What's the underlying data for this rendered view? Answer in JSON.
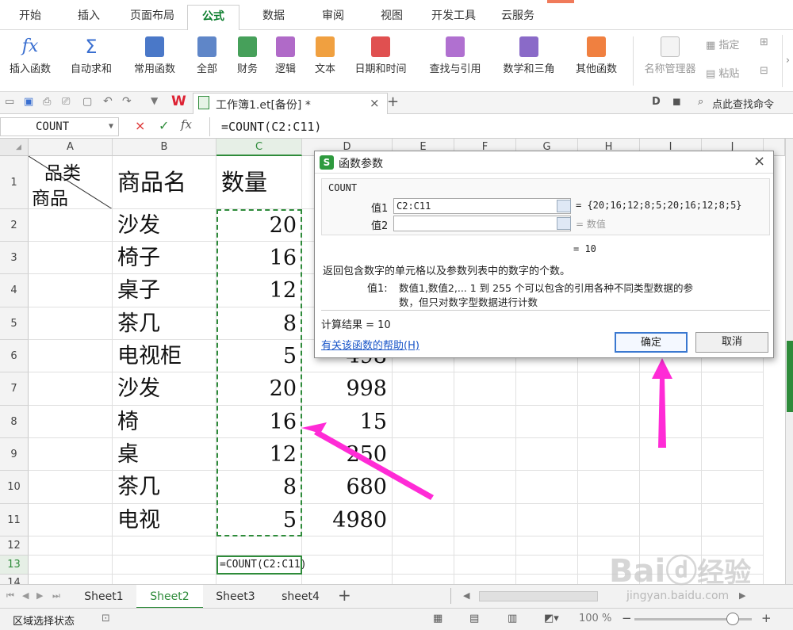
{
  "menu_tabs": [
    "开始",
    "插入",
    "页面布局",
    "公式",
    "数据",
    "审阅",
    "视图",
    "开发工具",
    "云服务"
  ],
  "active_menu_tab": "公式",
  "ribbon": {
    "items": [
      "插入函数",
      "自动求和",
      "常用函数",
      "全部",
      "财务",
      "逻辑",
      "文本",
      "日期和时间",
      "查找与引用",
      "数学和三角",
      "其他函数"
    ],
    "right_items": [
      "名称管理器",
      "指定",
      "粘贴"
    ],
    "fx_glyph": "fx",
    "sum_glyph": "Σ"
  },
  "doc_tab": {
    "title": "工作簿1.et[备份] *",
    "close": "×",
    "add": "+"
  },
  "tab_right": {
    "find": "点此查找命令"
  },
  "formula_bar": {
    "name_box": "COUNT",
    "cancel": "×",
    "confirm": "✓",
    "fx": "fx",
    "formula": "=COUNT(C2:C11)"
  },
  "columns": [
    "A",
    "B",
    "C",
    "D",
    "E",
    "F",
    "G",
    "H",
    "I",
    "J"
  ],
  "rows": [
    "1",
    "2",
    "3",
    "4",
    "5",
    "6",
    "7",
    "8",
    "9",
    "10",
    "11",
    "12",
    "13",
    "14"
  ],
  "header_cells": {
    "a1_top": "品类",
    "a1_bottom": "商品",
    "b1": "商品名",
    "c1": "数量"
  },
  "products": [
    "沙发",
    "椅子",
    "桌子",
    "茶几",
    "电视柜",
    "沙发",
    "椅",
    "桌",
    "茶几",
    "电视"
  ],
  "quantities": [
    "20",
    "16",
    "12",
    "8",
    "5",
    "20",
    "16",
    "12",
    "8",
    "5"
  ],
  "d_values": [
    "",
    "",
    "",
    "",
    "498",
    "998",
    "15",
    "250",
    "680",
    "4980"
  ],
  "c13_formula": "=COUNT(C2:C11)",
  "sheets": [
    "Sheet1",
    "Sheet2",
    "Sheet3",
    "sheet4"
  ],
  "active_sheet": "Sheet2",
  "status": {
    "mode": "区域选择状态",
    "zoom": "100 %",
    "zoom_level_percent": 100
  },
  "dialog": {
    "title": "函数参数",
    "func_name": "COUNT",
    "arg1_label": "值1",
    "arg1_value": "C2:C11",
    "arg1_result": "= {20;16;12;8;5;20;16;12;8;5}",
    "arg2_label": "值2",
    "arg2_result": "= 数值",
    "total": "= 10",
    "description": "返回包含数字的单元格以及参数列表中的数字的个数。",
    "param_label": "值1:",
    "param_desc_1": "数值1,数值2,... 1 到 255 个可以包含的引用各种不同类型数据的参",
    "param_desc_2": "数，但只对数字型数据进行计数",
    "calc_result": "计算结果 = 10",
    "help_link": "有关该函数的帮助(H)",
    "ok": "确定",
    "cancel": "取消",
    "close": "×"
  },
  "watermark": {
    "main": "Bai",
    "suffix": "经验",
    "url": "jingyan.baidu.com"
  },
  "colors": {
    "accent": "#2e8b3a",
    "highlight": "#ff2bd6",
    "link": "#1a56c8"
  }
}
